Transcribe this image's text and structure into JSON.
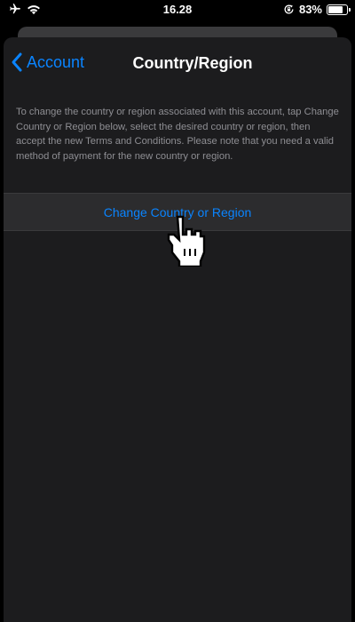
{
  "status_bar": {
    "time": "16.28",
    "battery_percent": "83%",
    "battery_level": 0.83,
    "icons": [
      "airplane-icon",
      "wifi-icon",
      "orientation-lock-icon",
      "battery-icon"
    ]
  },
  "nav": {
    "back_label": "Account",
    "title": "Country/Region"
  },
  "description": "To change the country or region associated with this account, tap Change Country or Region below, select the desired country or region, then accept the new Terms and Conditions. Please note that you need a valid method of payment for the new country or region.",
  "action": {
    "label": "Change Country or Region"
  },
  "colors": {
    "accent": "#0a84ff",
    "sheet_bg": "#1c1c1e",
    "row_bg": "#2c2c2e",
    "secondary_text": "#8e8e93"
  }
}
